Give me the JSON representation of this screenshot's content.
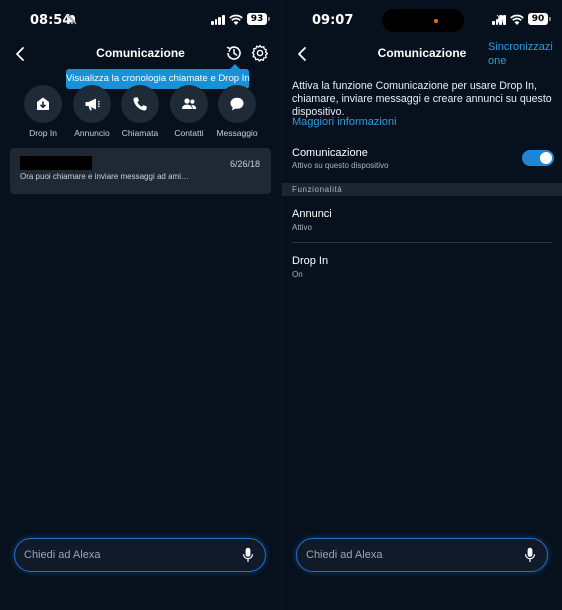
{
  "left": {
    "status": {
      "time": "08:54",
      "battery": "93"
    },
    "header": {
      "title": "Comunicazione"
    },
    "tooltip": "Visualizza la cronologia chiamate e Drop In",
    "actions": [
      {
        "label": "Drop In",
        "icon": "drop-in-icon"
      },
      {
        "label": "Annuncio",
        "icon": "megaphone-icon"
      },
      {
        "label": "Chiamata",
        "icon": "phone-icon"
      },
      {
        "label": "Contatti",
        "icon": "contacts-icon"
      },
      {
        "label": "Messaggio",
        "icon": "message-icon"
      }
    ],
    "conversation": {
      "date": "6/26/18",
      "preview": "Ora puoi chiamare e inviare messaggi ad ami…"
    },
    "alexa": {
      "placeholder": "Chiedi ad Alexa"
    }
  },
  "right": {
    "status": {
      "time": "09:07",
      "battery": "90"
    },
    "header": {
      "title": "Comunicazione",
      "sync": "Sincronizzazione"
    },
    "intro": "Attiva la funzione Comunicazione per usare Drop In, chiamare, inviare messaggi e creare annunci su questo dispositivo.",
    "more_link": "Maggiori informazioni",
    "communication": {
      "title": "Comunicazione",
      "subtitle": "Attivo su questo dispositivo",
      "enabled": true
    },
    "section": "Funzionalità",
    "features": [
      {
        "title": "Annunci",
        "subtitle": "Attivo"
      },
      {
        "title": "Drop In",
        "subtitle": "On"
      }
    ],
    "alexa": {
      "placeholder": "Chiedi ad Alexa"
    }
  },
  "colors": {
    "background": "#07111e",
    "accent": "#1e86d6",
    "link": "#2d9cdb",
    "tooltip": "#1891d6"
  }
}
